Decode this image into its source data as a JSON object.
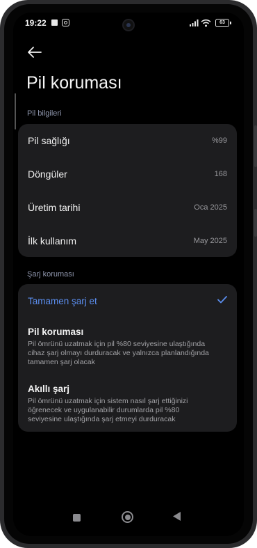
{
  "status_bar": {
    "time": "19:22",
    "battery_level": "63"
  },
  "header": {
    "title": "Pil koruması"
  },
  "battery_info": {
    "section_label": "Pil bilgileri",
    "rows": [
      {
        "label": "Pil sağlığı",
        "value": "%99"
      },
      {
        "label": "Döngüler",
        "value": "168"
      },
      {
        "label": "Üretim tarihi",
        "value": "Oca 2025"
      },
      {
        "label": "İlk kullanım",
        "value": "May 2025"
      }
    ]
  },
  "charge_protection": {
    "section_label": "Şarj koruması",
    "options": [
      {
        "title": "Tamamen şarj et",
        "description": "",
        "selected": true
      },
      {
        "title": "Pil koruması",
        "description": "Pil ömrünü uzatmak için pil %80 seviyesine ulaştığında cihaz şarj olmayı durduracak ve yalnızca planlandığında tamamen şarj olacak",
        "selected": false
      },
      {
        "title": "Akıllı şarj",
        "description": "Pil ömrünü uzatmak için sistem nasıl şarj ettiğinizi öğrenecek ve uygulanabilir durumlarda pil %80 seviyesine ulaştığında şarj etmeyi durduracak",
        "selected": false
      }
    ]
  },
  "colors": {
    "accent": "#5b8eef",
    "card_background": "#1d1d1f",
    "section_label": "#8f96ad"
  },
  "icons": {
    "back": "arrow-left-icon",
    "check": "check-icon"
  }
}
